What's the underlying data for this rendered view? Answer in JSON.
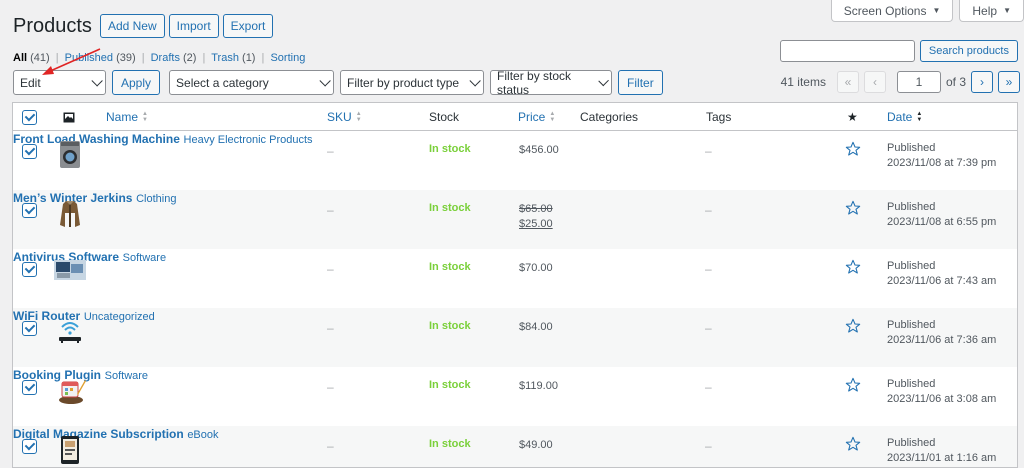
{
  "header": {
    "title": "Products",
    "actions": [
      "Add New",
      "Import",
      "Export"
    ],
    "screen_options": "Screen Options",
    "help": "Help"
  },
  "filters": {
    "views": [
      {
        "label": "All",
        "count": "(41)"
      },
      {
        "label": "Published",
        "count": "(39)"
      },
      {
        "label": "Drafts",
        "count": "(2)"
      },
      {
        "label": "Trash",
        "count": "(1)"
      },
      {
        "label": "Sorting",
        "count": ""
      }
    ]
  },
  "search": {
    "value": "",
    "button": "Search products"
  },
  "tablenav": {
    "bulk_action": "Edit",
    "apply": "Apply",
    "category": "Select a category",
    "product_type": "Filter by product type",
    "stock_status": "Filter by stock status",
    "filter": "Filter"
  },
  "pagination": {
    "items": "41 items",
    "current_page": "1",
    "of": "of 3",
    "first": "«",
    "prev": "‹",
    "next": "›",
    "last": "»"
  },
  "columns": {
    "name": "Name",
    "sku": "SKU",
    "stock": "Stock",
    "price": "Price",
    "categories": "Categories",
    "tags": "Tags",
    "featured": "★",
    "date": "Date"
  },
  "rows": [
    {
      "name": "Front Load Washing Machine",
      "sku": "–",
      "stock": "In stock",
      "price": "$456.00",
      "price_old": "",
      "categories": "Heavy Electronic Products",
      "tags": "–",
      "date_status": "Published",
      "date": "2023/11/08 at 7:39 pm",
      "thumb": "washing-machine"
    },
    {
      "name": "Men’s Winter Jerkins",
      "sku": "–",
      "stock": "In stock",
      "price": "$25.00",
      "price_old": "$65.00",
      "categories": "Clothing",
      "tags": "–",
      "date_status": "Published",
      "date": "2023/11/08 at 6:55 pm",
      "thumb": "jacket"
    },
    {
      "name": "Antivirus Software",
      "sku": "–",
      "stock": "In stock",
      "price": "$70.00",
      "price_old": "",
      "categories": "Software",
      "tags": "–",
      "date_status": "Published",
      "date": "2023/11/06 at 7:43 am",
      "thumb": "laptop"
    },
    {
      "name": "WiFi Router",
      "sku": "–",
      "stock": "In stock",
      "price": "$84.00",
      "price_old": "",
      "categories": "Uncategorized",
      "tags": "–",
      "date_status": "Published",
      "date": "2023/11/06 at 7:36 am",
      "thumb": "router"
    },
    {
      "name": "Booking Plugin",
      "sku": "–",
      "stock": "In stock",
      "price": "$119.00",
      "price_old": "",
      "categories": "Software",
      "tags": "–",
      "date_status": "Published",
      "date": "2023/11/06 at 3:08 am",
      "thumb": "calendar"
    },
    {
      "name": "Digital Magazine Subscription",
      "sku": "–",
      "stock": "In stock",
      "price": "$49.00",
      "price_old": "",
      "categories": "eBook",
      "tags": "–",
      "date_status": "Published",
      "date": "2023/11/01 at 1:16 am",
      "thumb": "tablet"
    }
  ],
  "colors": {
    "accent": "#2271b1",
    "in_stock": "#7ad03a",
    "annotation_arrow": "#e02424"
  }
}
